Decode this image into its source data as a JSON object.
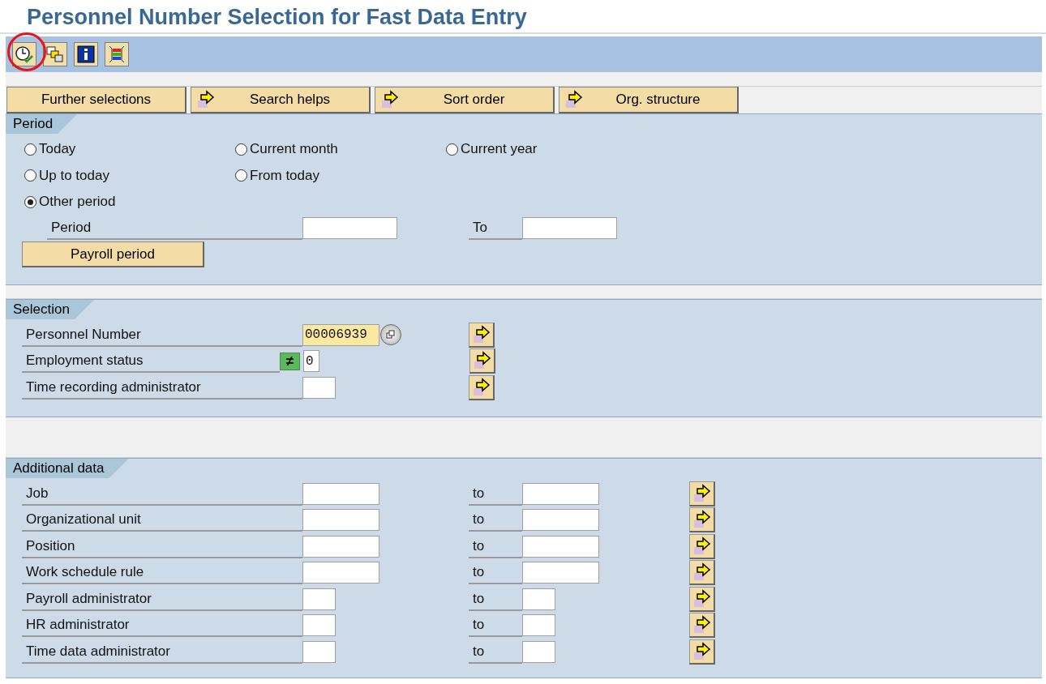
{
  "title": "Personnel Number Selection for Fast Data Entry",
  "toolbar": [
    {
      "kind": "execute",
      "highlighted": true
    },
    {
      "kind": "variant",
      "highlighted": false
    },
    {
      "kind": "info",
      "highlighted": false
    },
    {
      "kind": "layout",
      "highlighted": false
    }
  ],
  "tab_buttons": [
    {
      "label": "Further selections",
      "arrow": false
    },
    {
      "label": "Search helps",
      "arrow": true
    },
    {
      "label": "Sort order",
      "arrow": true
    },
    {
      "label": "Org. structure",
      "arrow": true
    }
  ],
  "period": {
    "title": "Period",
    "option_rows": [
      [
        {
          "label": "Today",
          "selected": false
        },
        {
          "label": "Current month",
          "selected": false
        },
        {
          "label": "Current year",
          "selected": false
        }
      ],
      [
        {
          "label": "Up to today",
          "selected": false
        },
        {
          "label": "From today",
          "selected": false
        }
      ],
      [
        {
          "label": "Other period",
          "selected": true
        }
      ]
    ],
    "period_label": "Period",
    "to_label": "To",
    "button": "Payroll period"
  },
  "selection": {
    "title": "Selection",
    "rows": [
      {
        "label": "Personnel Number",
        "kind": "long",
        "value": "00006939",
        "focused": true,
        "search_help": true
      },
      {
        "label": "Employment status",
        "kind": "tiny",
        "value": "0",
        "operator": "≠",
        "focused": false,
        "search_help": false
      },
      {
        "label": "Time recording administrator",
        "kind": "short",
        "focused": false,
        "search_help": false
      }
    ]
  },
  "additional": {
    "title": "Additional data",
    "rows": [
      {
        "label": "Job",
        "kind": "long",
        "to_label": "to"
      },
      {
        "label": "Organizational unit",
        "kind": "long",
        "to_label": "to"
      },
      {
        "label": "Position",
        "kind": "long",
        "to_label": "to"
      },
      {
        "label": "Work schedule rule",
        "kind": "long",
        "to_label": "to"
      },
      {
        "label": "Payroll administrator",
        "kind": "short",
        "to_label": "to"
      },
      {
        "label": "HR administrator",
        "kind": "short",
        "to_label": "to"
      },
      {
        "label": "Time data administrator",
        "kind": "short",
        "to_label": "to"
      }
    ]
  }
}
